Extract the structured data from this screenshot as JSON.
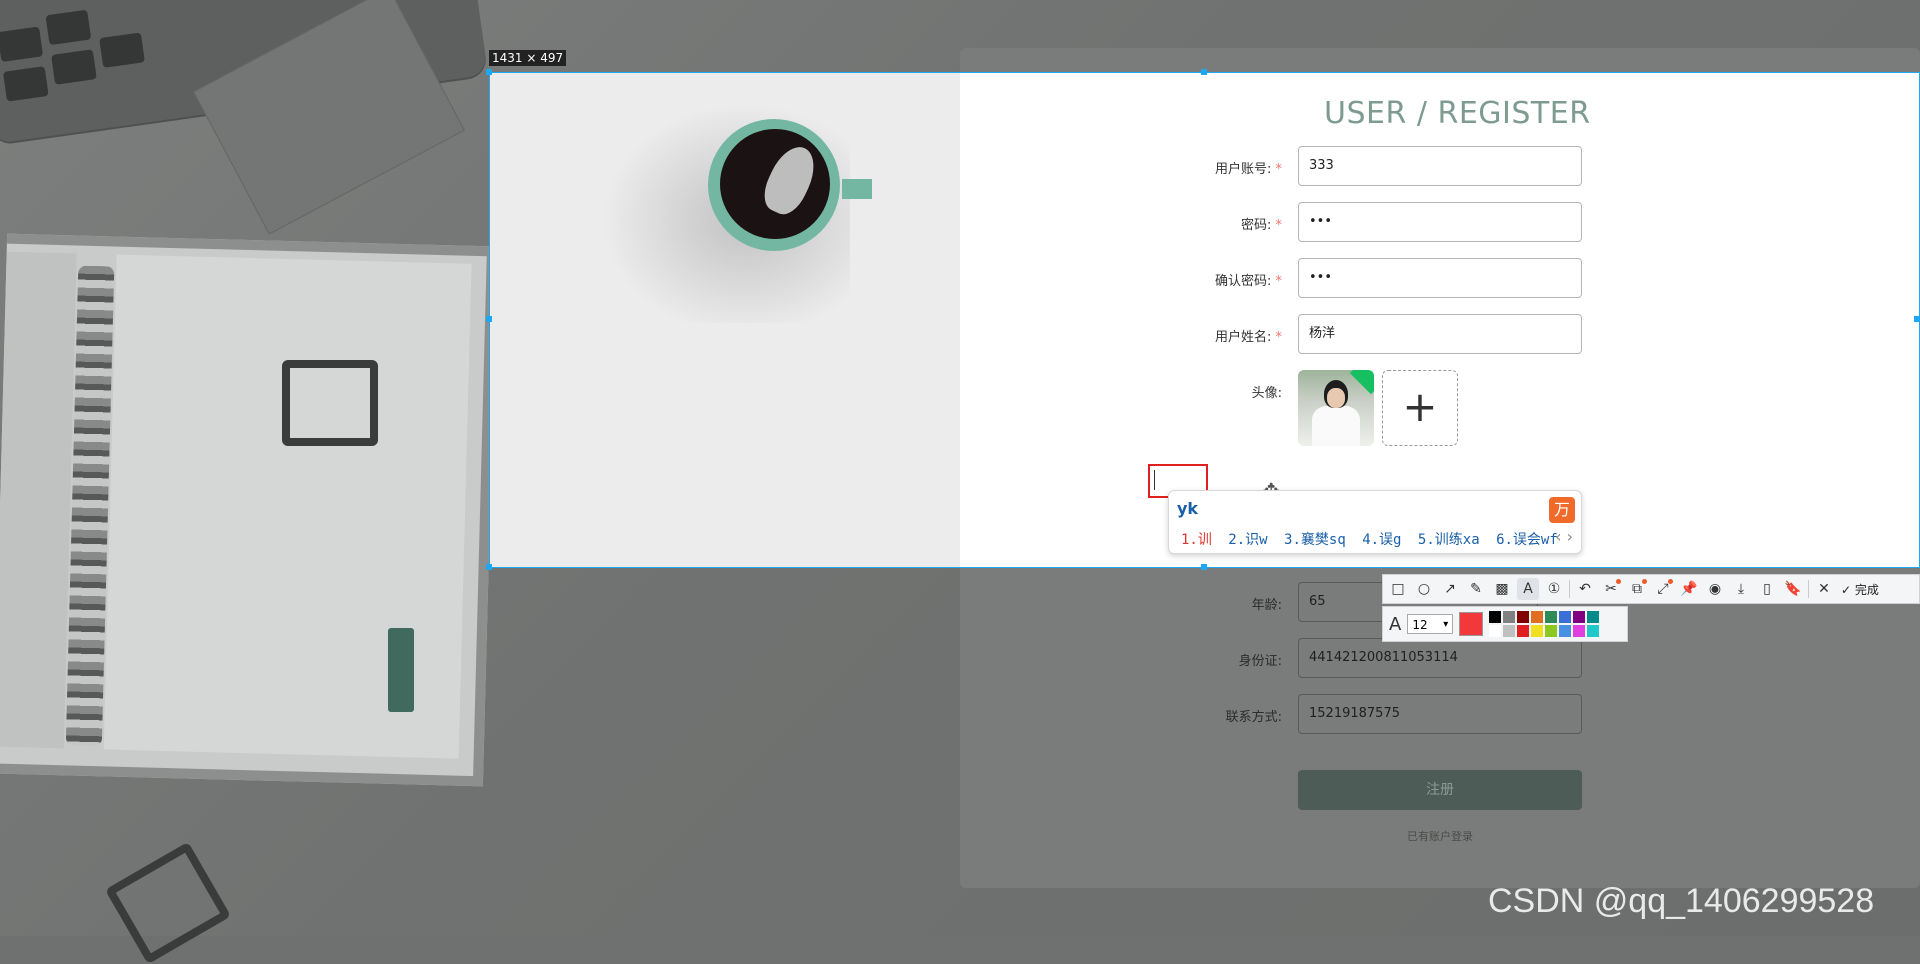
{
  "screenshot": {
    "selection_size_label": "1431 × 497"
  },
  "form": {
    "title": "USER / REGISTER",
    "fields": [
      {
        "label": "用户账号:",
        "required": true,
        "value": "333"
      },
      {
        "label": "密码:",
        "required": true,
        "value": "•••"
      },
      {
        "label": "确认密码:",
        "required": true,
        "value": "•••"
      },
      {
        "label": "用户姓名:",
        "required": true,
        "value": "杨洋"
      }
    ],
    "avatar_label": "头像:",
    "upload_icon": "+",
    "lower_fields": [
      {
        "label": "年龄:",
        "value": "65"
      },
      {
        "label": "身份证:",
        "value": "441421200811053114"
      },
      {
        "label": "联系方式:",
        "value": "15219187575"
      }
    ],
    "register_button": "注册",
    "login_link": "已有账户登录"
  },
  "ime": {
    "composition": "yk",
    "logo_glyph": "万",
    "candidates": [
      "1.训",
      "2.识w",
      "3.襄樊sq",
      "4.误g",
      "5.训练xa",
      "6.误会wf"
    ],
    "nav": "‹ ›"
  },
  "annotation_toolbar": {
    "tools": [
      {
        "name": "rectangle-tool",
        "glyph": "□"
      },
      {
        "name": "ellipse-tool",
        "glyph": "○"
      },
      {
        "name": "arrow-tool",
        "glyph": "↗"
      },
      {
        "name": "pen-tool",
        "glyph": "✎"
      },
      {
        "name": "mosaic-tool",
        "glyph": "▩"
      },
      {
        "name": "text-tool",
        "glyph": "A",
        "active": true
      },
      {
        "name": "number-tool",
        "glyph": "①"
      },
      {
        "name": "undo-tool",
        "glyph": "↶"
      },
      {
        "name": "cutout-tool",
        "glyph": "✂"
      },
      {
        "name": "ocr-tool",
        "glyph": "⧉"
      },
      {
        "name": "capture-tool",
        "glyph": "⤢"
      },
      {
        "name": "pin-tool",
        "glyph": "📌"
      },
      {
        "name": "record-tool",
        "glyph": "◉"
      },
      {
        "name": "download-tool",
        "glyph": "⤓"
      },
      {
        "name": "phone-tool",
        "glyph": "▯"
      },
      {
        "name": "bookmark-tool",
        "glyph": "🔖"
      },
      {
        "name": "close-tool",
        "glyph": "✕"
      }
    ],
    "done_label": "完成",
    "font_size": "12",
    "current_color": "#f2383a",
    "palette": [
      "#000000",
      "#808080",
      "#800000",
      "#e07020",
      "#2e8b57",
      "#3a6fd8",
      "#800080",
      "#008b8b",
      "#ffffff",
      "#c0c0c0",
      "#e02020",
      "#f0e020",
      "#8cc820",
      "#4a90e2",
      "#e040e0",
      "#20c8c8"
    ]
  },
  "watermark": "CSDN @qq_1406299528"
}
